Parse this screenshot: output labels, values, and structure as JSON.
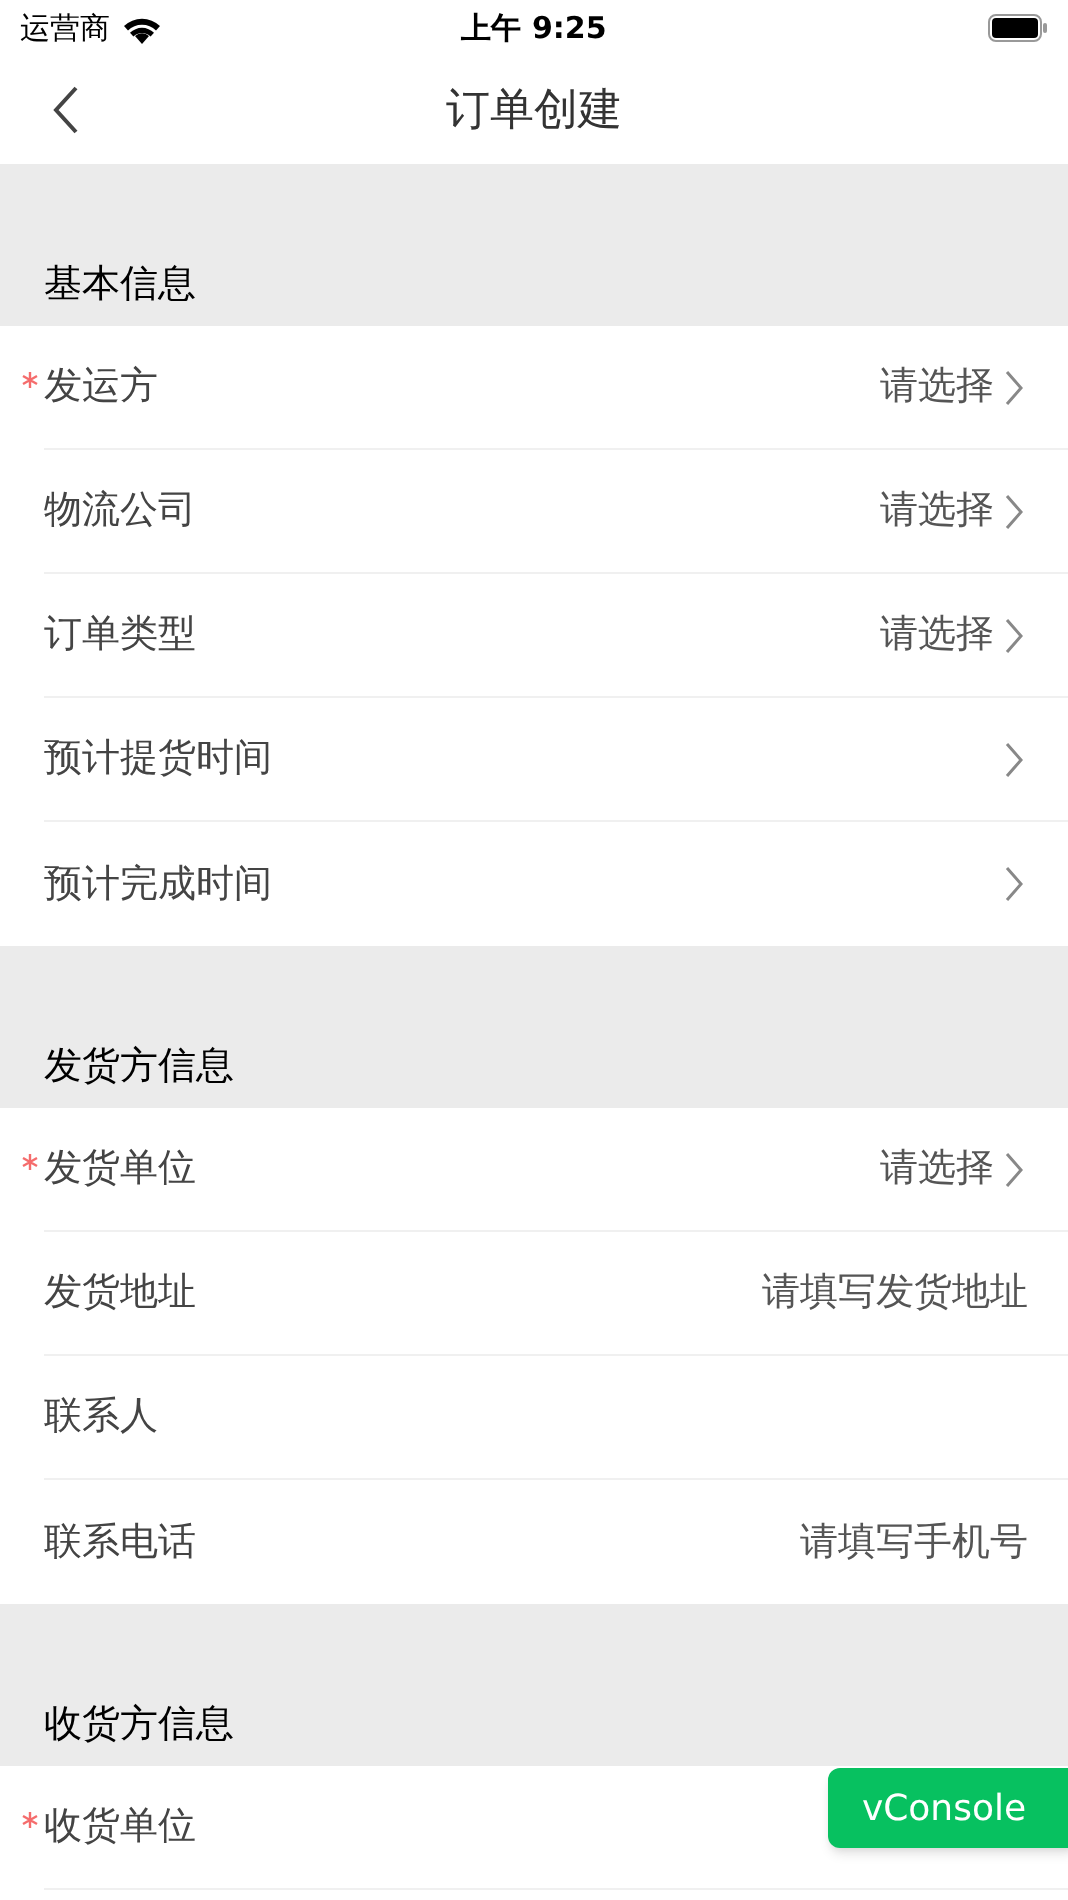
{
  "status_bar": {
    "carrier": "运营商",
    "time": "上午 9:25"
  },
  "nav": {
    "title": "订单创建"
  },
  "sections": [
    {
      "title": "基本信息",
      "rows": [
        {
          "label": "发运方",
          "required": true,
          "value": "请选择",
          "arrow": true
        },
        {
          "label": "物流公司",
          "required": false,
          "value": "请选择",
          "arrow": true
        },
        {
          "label": "订单类型",
          "required": false,
          "value": "请选择",
          "arrow": true
        },
        {
          "label": "预计提货时间",
          "required": false,
          "arrow": true
        },
        {
          "label": "预计完成时间",
          "required": false,
          "arrow": true
        }
      ]
    },
    {
      "title": "发货方信息",
      "rows": [
        {
          "label": "发货单位",
          "required": true,
          "value": "请选择",
          "arrow": true
        },
        {
          "label": "发货地址",
          "required": false,
          "value": "请填写发货地址",
          "arrow": false
        },
        {
          "label": "联系人",
          "required": false,
          "arrow": false
        },
        {
          "label": "联系电话",
          "required": false,
          "value": "请填写手机号",
          "arrow": false
        }
      ]
    },
    {
      "title": "收货方信息",
      "rows": [
        {
          "label": "收货单位",
          "required": true,
          "arrow": false
        }
      ]
    }
  ],
  "vconsole_button": "vConsole"
}
